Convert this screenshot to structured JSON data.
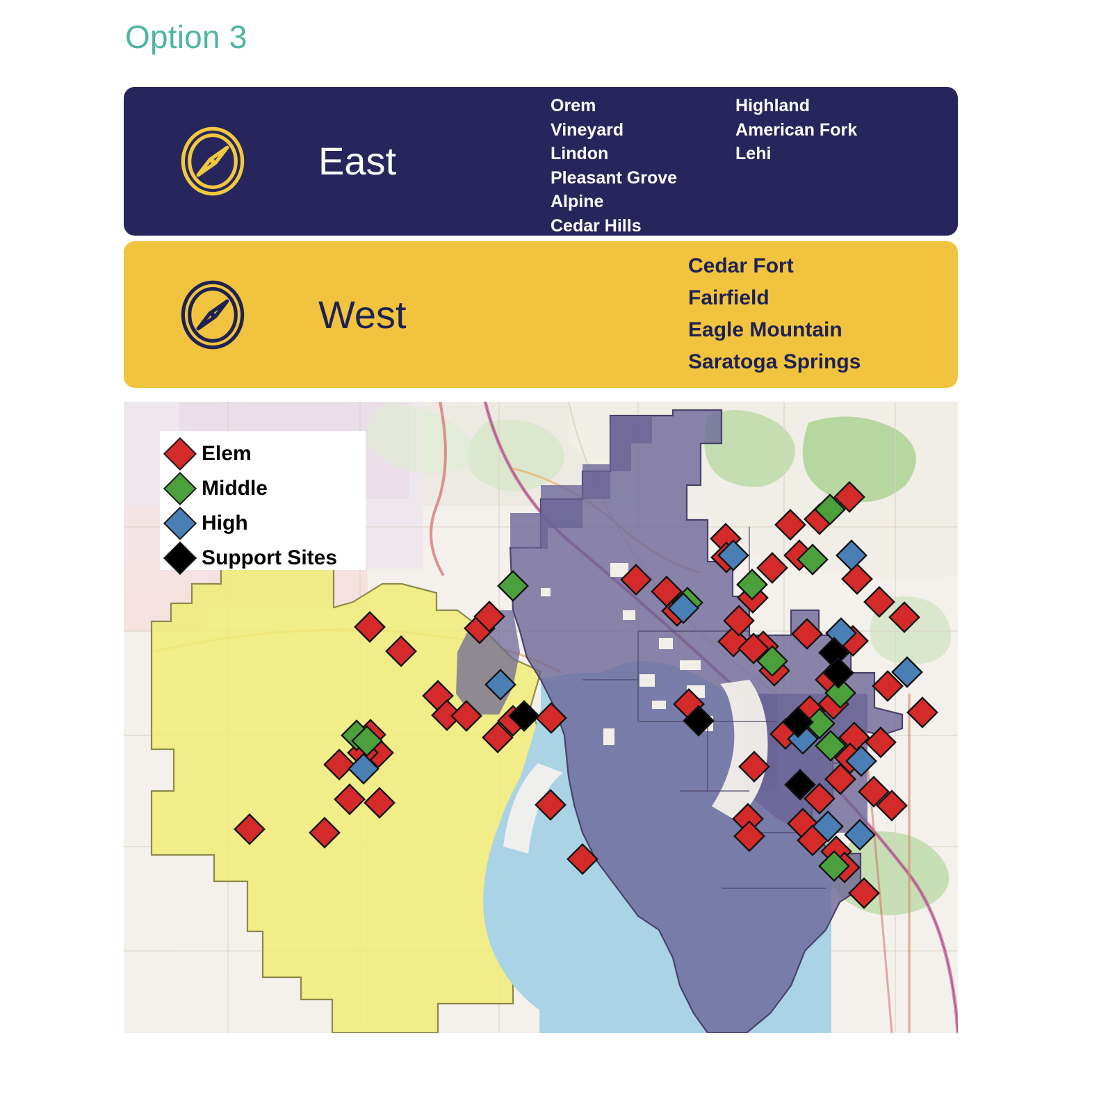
{
  "page": {
    "title": "Option 3",
    "title_color": "#4db6a0"
  },
  "regions": [
    {
      "key": "east",
      "name": "East",
      "icon": "compass-icon",
      "background_color": "#26265c",
      "text_color": "#ffffff",
      "columns": [
        [
          "Orem",
          "Vineyard",
          "Lindon",
          "Pleasant Grove",
          "Alpine",
          "Cedar Hills"
        ],
        [
          "Highland",
          "American Fork",
          "Lehi"
        ]
      ]
    },
    {
      "key": "west",
      "name": "West",
      "icon": "compass-icon",
      "background_color": "#f2c33e",
      "text_color": "#1e2252",
      "columns": [
        [
          "Cedar Fort",
          "Fairfield",
          "Eagle Mountain",
          "Saratoga Springs"
        ]
      ]
    }
  ],
  "map": {
    "legend": {
      "items": [
        {
          "label": "Elem",
          "color": "#d42a2a"
        },
        {
          "label": "Middle",
          "color": "#4ba03c"
        },
        {
          "label": "High",
          "color": "#4a7fb5"
        },
        {
          "label": "Support Sites",
          "color": "#000000"
        }
      ]
    },
    "overlays": {
      "east_region_fill": "#6a6496",
      "west_region_fill": "#f0ec7a",
      "lake_fill": "#aad3e6",
      "basemap_fill": "#f4f1ec"
    },
    "markers": {
      "elem_count": 62,
      "middle_count": 12,
      "high_count": 11,
      "support_count": 6
    }
  }
}
